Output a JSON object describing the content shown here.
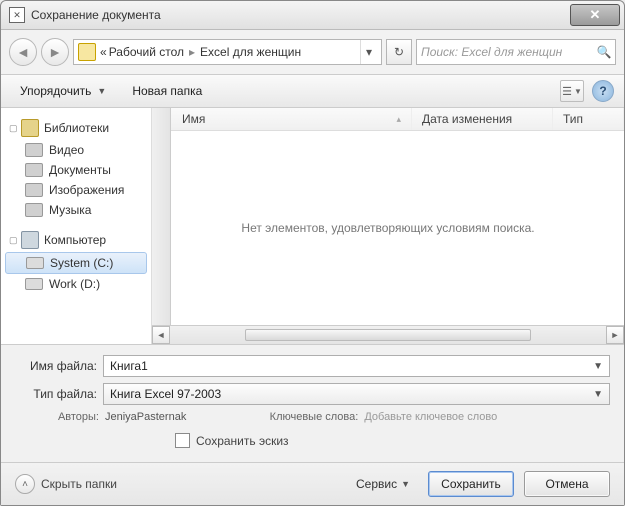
{
  "window": {
    "title": "Сохранение документа"
  },
  "breadcrumb": {
    "prefix": "«",
    "items": [
      "Рабочий стол",
      "Excel для женщин"
    ]
  },
  "search": {
    "placeholder": "Поиск: Excel для женщин"
  },
  "toolbar": {
    "organize": "Упорядочить",
    "new_folder": "Новая папка"
  },
  "sidebar": {
    "libraries": {
      "label": "Библиотеки",
      "items": [
        "Видео",
        "Документы",
        "Изображения",
        "Музыка"
      ]
    },
    "computer": {
      "label": "Компьютер",
      "drives": [
        "System (C:)",
        "Work (D:)"
      ],
      "selected_index": 0
    }
  },
  "columns": {
    "name": "Имя",
    "date": "Дата изменения",
    "type": "Тип"
  },
  "filelist": {
    "empty": "Нет элементов, удовлетворяющих условиям поиска."
  },
  "form": {
    "filename_label": "Имя файла:",
    "filename_value": "Книга1",
    "filetype_label": "Тип файла:",
    "filetype_value": "Книга Excel 97-2003",
    "authors_label": "Авторы:",
    "authors_value": "JeniyaPasternak",
    "keywords_label": "Ключевые слова:",
    "keywords_value": "Добавьте ключевое слово",
    "save_thumb": "Сохранить эскиз"
  },
  "footer": {
    "hide_folders": "Скрыть папки",
    "service": "Сервис",
    "save": "Сохранить",
    "cancel": "Отмена"
  }
}
